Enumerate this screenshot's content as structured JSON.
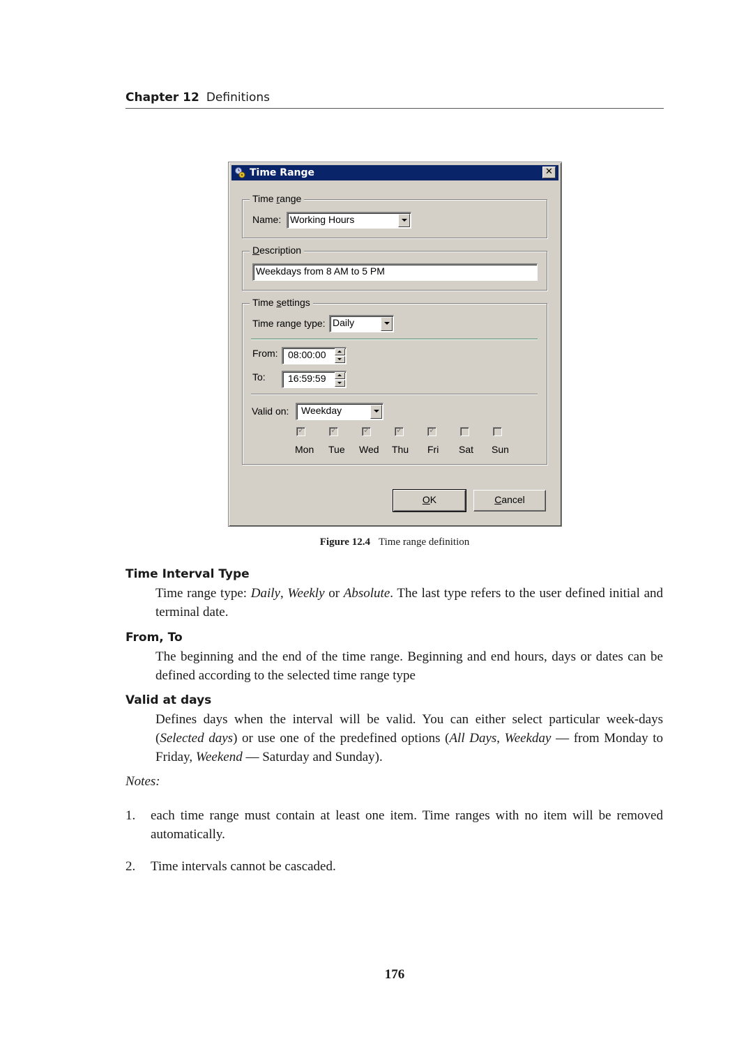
{
  "page": {
    "chapter_label": "Chapter 12",
    "chapter_title": "Definitions",
    "page_number": "176"
  },
  "dialog": {
    "title": "Time Range",
    "title_icon": "clock-gear-icon",
    "close_label": "✕",
    "time_range_group": {
      "legend_pre": "Time ",
      "legend_ul": "r",
      "legend_post": "ange",
      "name_label": "Name:",
      "name_value": "Working Hours"
    },
    "description_group": {
      "legend_ul": "D",
      "legend_post": "escription",
      "value": "Weekdays from 8 AM to 5 PM"
    },
    "time_settings_group": {
      "legend_pre": "Time ",
      "legend_ul": "s",
      "legend_post": "ettings",
      "type_label": "Time range type:",
      "type_value": "Daily",
      "from_label": "From:",
      "from_value": "08:00:00",
      "to_label": "To:",
      "to_value": "16:59:59",
      "valid_on_label": "Valid on:",
      "valid_on_value": "Weekday",
      "days": [
        {
          "label": "Mon",
          "checked": true
        },
        {
          "label": "Tue",
          "checked": true
        },
        {
          "label": "Wed",
          "checked": true
        },
        {
          "label": "Thu",
          "checked": true
        },
        {
          "label": "Fri",
          "checked": true
        },
        {
          "label": "Sat",
          "checked": false
        },
        {
          "label": "Sun",
          "checked": false
        }
      ]
    },
    "ok_ul": "O",
    "ok_post": "K",
    "cancel_ul": "C",
    "cancel_post": "ancel"
  },
  "figure": {
    "number": "Figure 12.4",
    "caption": "Time range definition"
  },
  "sections": {
    "interval_type": {
      "heading": "Time Interval Type",
      "t1": "Time range type: ",
      "i1": "Daily",
      "t2": ", ",
      "i2": "Weekly",
      "t3": " or ",
      "i3": "Absolute",
      "t4": ". The last type refers to the user defined initial and terminal date."
    },
    "from_to": {
      "heading": "From, To",
      "text": "The beginning and the end of the time range.  Beginning and end hours, days or dates can be defined according to the selected time range type"
    },
    "valid_days": {
      "heading": "Valid at days",
      "t1": "Defines days when the interval will be valid. You can either select particular week-days (",
      "i1": "Selected days",
      "t2": ") or use one of the predefined options (",
      "i2": "All Days",
      "t3": ", ",
      "i3": "Weekday",
      "t4": " — from Monday to Friday, ",
      "i4": "Weekend",
      "t5": " — Saturday and Sunday)."
    }
  },
  "notes": {
    "label": "Notes:",
    "items": [
      {
        "num": "1.",
        "text": "each time range must contain at least one item.  Time ranges with no item will be removed automatically."
      },
      {
        "num": "2.",
        "text": "Time intervals cannot be cascaded."
      }
    ]
  }
}
